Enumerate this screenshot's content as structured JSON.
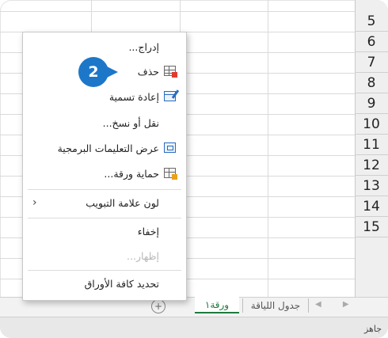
{
  "grid": {
    "row_numbers": [
      "5",
      "6",
      "7",
      "8",
      "9",
      "10",
      "11",
      "12",
      "13",
      "14",
      "15"
    ]
  },
  "context_menu": {
    "items": [
      {
        "label": "إدراج...",
        "icon": "",
        "disabled": false
      },
      {
        "label": "حذف",
        "icon": "delete-sheet-icon",
        "disabled": false
      },
      {
        "label": "إعادة تسمية",
        "icon": "rename-icon",
        "disabled": false
      },
      {
        "label": "نقل أو نسخ...",
        "icon": "",
        "disabled": false
      },
      {
        "label": "عرض التعليمات البرمجية",
        "icon": "view-code-icon",
        "disabled": false
      },
      {
        "label": "حماية ورقة...",
        "icon": "protect-sheet-icon",
        "disabled": false
      },
      {
        "label": "لون علامة التبويب",
        "icon": "chevron-left-icon",
        "disabled": false,
        "submenu": true
      },
      {
        "label": "إخفاء",
        "icon": "",
        "disabled": false
      },
      {
        "label": "إظهار...",
        "icon": "",
        "disabled": true
      },
      {
        "label": "تحديد كافة الأوراق",
        "icon": "",
        "disabled": false
      }
    ]
  },
  "callout": {
    "number": "2",
    "color": "#1d77c9"
  },
  "sheet_tabs": {
    "active": "ورقة١",
    "inactive": "جدول اللياقة",
    "add_symbol": "+",
    "active_color": "#1f7a3d"
  },
  "status_bar": {
    "text": "جاهز"
  }
}
